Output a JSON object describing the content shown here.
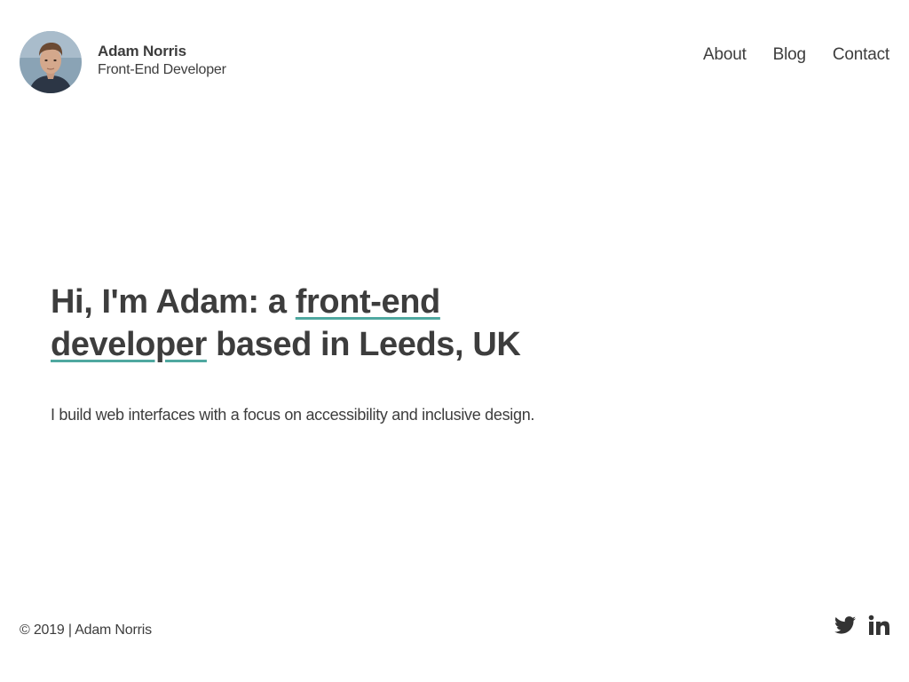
{
  "header": {
    "name": "Adam Norris",
    "role": "Front-End Developer",
    "avatar_icon": "profile-photo",
    "nav": [
      {
        "label": "About"
      },
      {
        "label": "Blog"
      },
      {
        "label": "Contact"
      }
    ]
  },
  "hero": {
    "headline_prefix": "Hi, I'm Adam: a ",
    "headline_link": "front-end developer",
    "headline_suffix": " based in Leeds, UK",
    "subtitle": "I build web interfaces with a focus on accessibility and inclusive design."
  },
  "footer": {
    "copyright": "© 2019 | Adam Norris",
    "social": [
      {
        "icon": "twitter-icon"
      },
      {
        "icon": "linkedin-icon"
      }
    ]
  },
  "colors": {
    "text": "#3d3d3d",
    "accent": "#4fa8a0",
    "background": "#ffffff"
  }
}
